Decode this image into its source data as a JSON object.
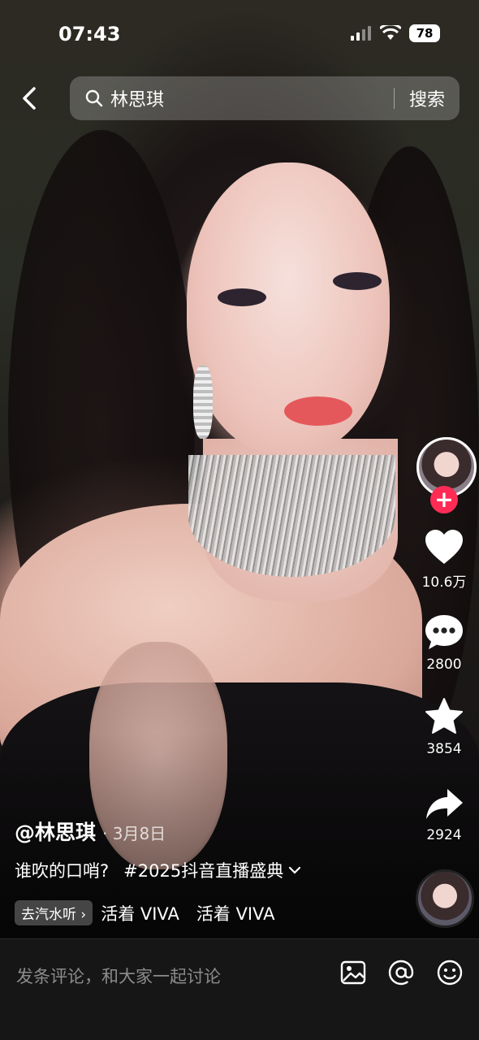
{
  "status_bar": {
    "time": "07:43",
    "battery": "78"
  },
  "search": {
    "query": "林思琪",
    "button_label": "搜索"
  },
  "actions": {
    "likes": "10.6万",
    "comments": "2800",
    "favorites": "3854",
    "shares": "2924"
  },
  "post": {
    "author": "@林思琪",
    "date": "· 3月8日",
    "description": "谁吹的口哨?",
    "hashtag": "#2025抖音直播盛典",
    "music_chip": "去汽水听 ›",
    "music_title": "活着 VIVA　活着 VIVA"
  },
  "comment_bar": {
    "placeholder": "发条评论，和大家一起讨论"
  },
  "colors": {
    "accent": "#fe2c55",
    "bottom_bar": "#161616"
  }
}
